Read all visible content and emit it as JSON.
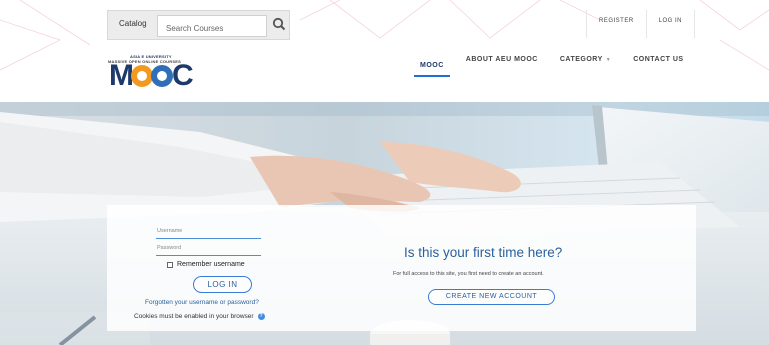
{
  "topbar": {
    "catalog_label": "Catalog",
    "search_placeholder": "Search Courses",
    "register_label": "REGISTER",
    "login_label": "LOG IN"
  },
  "logo": {
    "university": "ASIA E UNIVERSITY",
    "subtitle": "MASSIVE OPEN ONLINE COURSES",
    "word_m": "M",
    "word_c": "C"
  },
  "nav": {
    "items": [
      {
        "label": "MOOC",
        "active": true
      },
      {
        "label": "ABOUT AEU MOOC",
        "active": false
      },
      {
        "label": "CATEGORY",
        "active": false,
        "dropdown": true
      },
      {
        "label": "CONTACT US",
        "active": false
      }
    ]
  },
  "login": {
    "username_placeholder": "Username",
    "password_placeholder": "Password",
    "remember_label": "Remember username",
    "login_button": "LOG IN",
    "forgot_link": "Forgotten your username or password?",
    "cookies_text": "Cookies must be enabled in your browser",
    "first_time_heading": "Is this your first time here?",
    "full_access_text": "For full access to this site, you first need to create an account.",
    "create_account_button": "CREATE NEW ACCOUNT"
  },
  "colors": {
    "brand_navy": "#1e3a6b",
    "brand_orange": "#f29a1f",
    "brand_blue": "#2e6fb7",
    "link_blue": "#2a5f9e",
    "accent_underline": "#1f6fd6"
  }
}
